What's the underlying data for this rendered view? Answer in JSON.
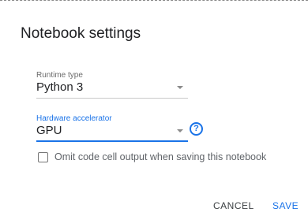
{
  "dialog": {
    "title": "Notebook settings"
  },
  "runtime": {
    "label": "Runtime type",
    "value": "Python 3"
  },
  "accelerator": {
    "label": "Hardware accelerator",
    "value": "GPU",
    "help_icon_glyph": "?"
  },
  "omit_output": {
    "label": "Omit code cell output when saving this notebook",
    "checked": false
  },
  "actions": {
    "cancel_label": "CANCEL",
    "save_label": "SAVE"
  },
  "colors": {
    "accent": "#1a73e8",
    "text": "#202124",
    "muted": "#6b6b6b"
  },
  "icons": {
    "dropdown": "chevron-down-icon",
    "help": "help-circle-icon"
  }
}
